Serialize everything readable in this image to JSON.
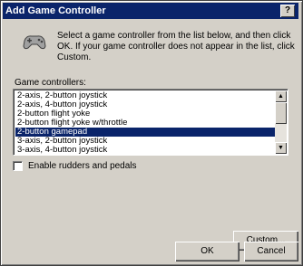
{
  "window": {
    "title": "Add Game Controller",
    "help_label": "?"
  },
  "instructions": "Select a game controller from the list below, and then click OK. If your game controller does not appear in the list, click Custom.",
  "list": {
    "label": "Game controllers:",
    "items": [
      "2-axis, 2-button joystick",
      "2-axis, 4-button joystick",
      "2-button flight yoke",
      "2-button flight yoke w/throttle",
      "2-button gamepad",
      "3-axis, 2-button joystick",
      "3-axis, 4-button joystick"
    ],
    "selected": "2-button gamepad"
  },
  "checkbox": {
    "label": "Enable rudders and pedals",
    "checked": false
  },
  "buttons": {
    "custom": "Custom...",
    "ok": "OK",
    "cancel": "Cancel"
  },
  "colors": {
    "title_bar": "#0a246a",
    "selection": "#0a246a",
    "dialog_face": "#d4d0c8"
  },
  "icons": {
    "dialog": "game-controller-icon",
    "scroll_up": "scroll-up-arrow-icon",
    "scroll_down": "scroll-down-arrow-icon"
  }
}
